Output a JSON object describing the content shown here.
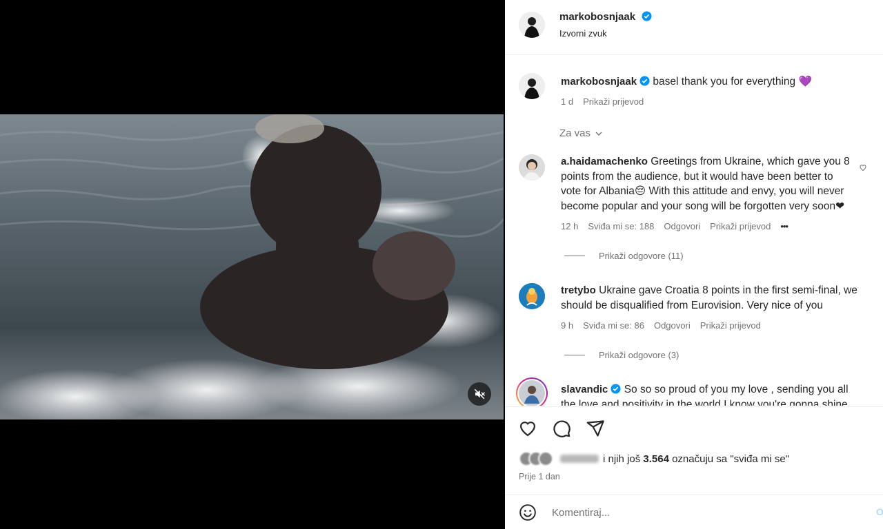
{
  "post": {
    "author": "markobosnjaak",
    "audio": "Izvorni zvuk",
    "caption": "basel thank you for everything",
    "caption_emoji": "💜",
    "age": "1 d",
    "translate": "Prikaži prijevod"
  },
  "filter_label": "Za vas",
  "comments": [
    {
      "user": "a.haidamachenko",
      "lines": [
        "Greetings from Ukraine, which gave you 8",
        "points from the audience, but it would have been better to",
        "vote for Albania😔 With this attitude and envy, you will never",
        "become popular and your song will be forgotten very soon❤"
      ],
      "age": "12 h",
      "likes": "Sviđa mi se: 188",
      "reply": "Odgovori",
      "translate": "Prikaži prijevod",
      "more": "•••",
      "view_replies": "Prikaži odgovore (11)"
    },
    {
      "user": "tretybo",
      "lines": [
        "Ukraine gave Croatia 8 points in the first semi-final, we",
        "should be disqualified from Eurovision. Very nice of you"
      ],
      "age": "9 h",
      "likes": "Sviđa mi se: 86",
      "reply": "Odgovori",
      "translate": "Prikaži prijevod",
      "view_replies": "Prikaži odgovore (3)"
    },
    {
      "user": "slavandic",
      "lines": [
        "So so so proud of you my love , sending you all",
        "the love and positivity in the world I know you're gonna shine"
      ]
    }
  ],
  "likes_summary": {
    "prefix": "i njih još",
    "count": "3.564",
    "suffix": "označuju sa \"sviđa mi se\""
  },
  "posted_ago": "Prije 1 dan",
  "comment_box": {
    "placeholder": "Komentiraj...",
    "post_label": "Objavi"
  },
  "colors": {
    "verified": "#0095f6",
    "muted_text": "#737373",
    "divider": "#efefef"
  }
}
